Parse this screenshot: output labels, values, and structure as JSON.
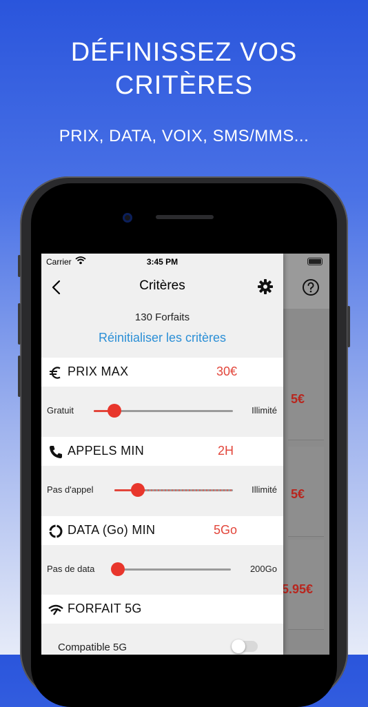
{
  "headline": "DÉFINISSEZ VOS CRITÈRES",
  "subline": "PRIX, DATA, VOIX, SMS/MMS...",
  "status": {
    "carrier": "Carrier",
    "time": "3:45 PM"
  },
  "nav": {
    "title": "Critères",
    "back_icon": "chevron-left-icon",
    "settings_icon": "gear-icon"
  },
  "summary": {
    "count": "130 Forfaits",
    "reset_label": "Réinitialiser les critères"
  },
  "sections": [
    {
      "label": "PRIX MAX",
      "value": "30€",
      "icon": "euro-icon",
      "min_label": "Gratuit",
      "max_label": "Illimité",
      "level": 0.15
    },
    {
      "label": "APPELS MIN",
      "value": "2H",
      "icon": "phone-icon",
      "min_label": "Pas d'appel",
      "max_label": "Illimité",
      "level": 0.2
    },
    {
      "label": "DATA (Go) MIN",
      "value": "5Go",
      "icon": "data-ring-icon",
      "min_label": "Pas de data",
      "max_label": "200Go",
      "level": 0.0
    },
    {
      "label": "FORFAIT 5G",
      "icon": "5g-signal-icon",
      "toggle_label": "Compatible 5G",
      "toggle_on": false
    }
  ],
  "background_results": {
    "prices": [
      "5€",
      "5€",
      "5.95€"
    ]
  },
  "colors": {
    "accent": "#e2453a",
    "link": "#2b8fd6",
    "bg_top": "#2a55dc"
  }
}
